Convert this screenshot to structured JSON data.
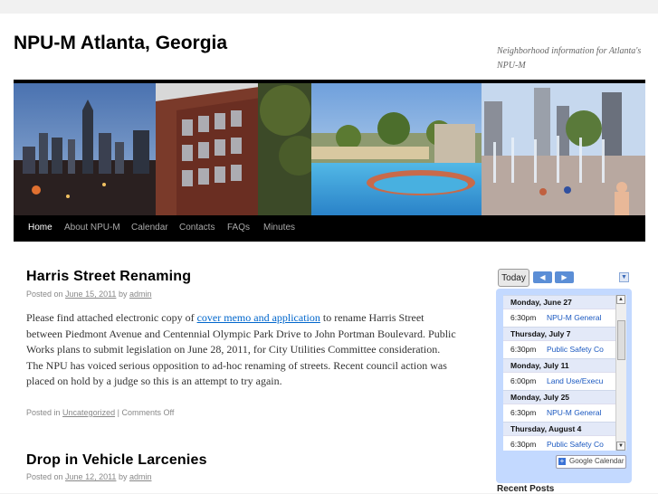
{
  "site": {
    "title": "NPU-M Atlanta, Georgia",
    "description": "Neighborhood information for Atlanta's NPU-M"
  },
  "nav": {
    "items": [
      {
        "label": "Home"
      },
      {
        "label": "About NPU-M"
      },
      {
        "label": "Calendar"
      },
      {
        "label": "Contacts"
      },
      {
        "label": "FAQs"
      },
      {
        "label": "Minutes"
      }
    ]
  },
  "posts": [
    {
      "title": "Harris Street Renaming",
      "posted_on_label": "Posted on",
      "date": "June 15, 2011",
      "by_label": "by",
      "author": "admin",
      "body_before_link": "Please find attached electronic copy of",
      "link_text": "cover memo and application",
      "body_after_link": "to rename Harris Street between Piedmont Avenue and Centennial Olympic Park Drive to John Portman Boulevard. Public Works plans to submit legislation on June 28, 2011, for City Utilities Committee consideration.  The NPU has voiced serious opposition to ad-hoc renaming of streets.  Recent council action was placed on hold by a judge so this is an attempt to try again.",
      "posted_in_label": "Posted in",
      "category": "Uncategorized",
      "separator": "|",
      "comments": "Comments Off"
    },
    {
      "title": "Drop in Vehicle Larcenies",
      "posted_on_label": "Posted on",
      "date": "June 12, 2011",
      "by_label": "by",
      "author": "admin"
    }
  ],
  "calendar": {
    "today_label": "Today",
    "prev_icon": "left-arrow-icon",
    "next_icon": "right-arrow-icon",
    "badge_label": "Google Calendar",
    "entries": [
      {
        "date": "Monday, June 27",
        "time": "6:30pm",
        "event": "NPU-M General"
      },
      {
        "date": "Thursday, July 7",
        "time": "6:30pm",
        "event": "Public Safety Co"
      },
      {
        "date": "Monday, July 11",
        "time": "6:00pm",
        "event": "Land Use/Execu"
      },
      {
        "date": "Monday, July 25",
        "time": "6:30pm",
        "event": "NPU-M General"
      },
      {
        "date": "Thursday, August 4",
        "time": "6:30pm",
        "event": "Public Safety Co"
      }
    ]
  },
  "sidebar": {
    "recent_posts_heading": "Recent Posts"
  },
  "colors": {
    "link": "#0066cc",
    "calendar_frame": "#c3d9ff",
    "nav_bg": "#000000"
  }
}
